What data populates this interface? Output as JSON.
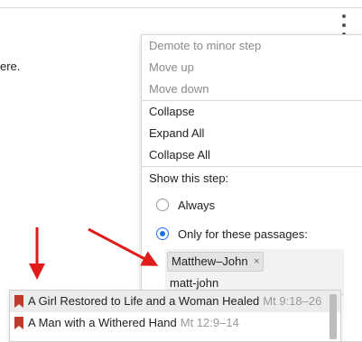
{
  "background": {
    "text_fragment": "ere."
  },
  "menu": {
    "items_group1": [
      {
        "label": "Demote to minor step",
        "enabled": false
      },
      {
        "label": "Move up",
        "enabled": false
      },
      {
        "label": "Move down",
        "enabled": false
      }
    ],
    "items_group2": [
      {
        "label": "Collapse",
        "enabled": true
      },
      {
        "label": "Expand All",
        "enabled": true
      },
      {
        "label": "Collapse All",
        "enabled": true
      }
    ],
    "show_step_label": "Show this step:",
    "radio_always": "Always",
    "radio_only": "Only for these passages:",
    "selected_option": "Only for these passages:"
  },
  "passage_picker": {
    "chip_label": "Matthew–John",
    "chip_remove": "×",
    "input_value": "matt-john"
  },
  "dropdown": {
    "items": [
      {
        "title": "A Girl Restored to Life and a Woman Healed",
        "ref": "Mt 9:18–26"
      },
      {
        "title": "A Man with a Withered Hand",
        "ref": "Mt 12:9–14"
      }
    ]
  },
  "colors": {
    "accent": "#1a73e8",
    "annotation_arrow": "#e01b1b",
    "bookmark": "#c0392b"
  }
}
